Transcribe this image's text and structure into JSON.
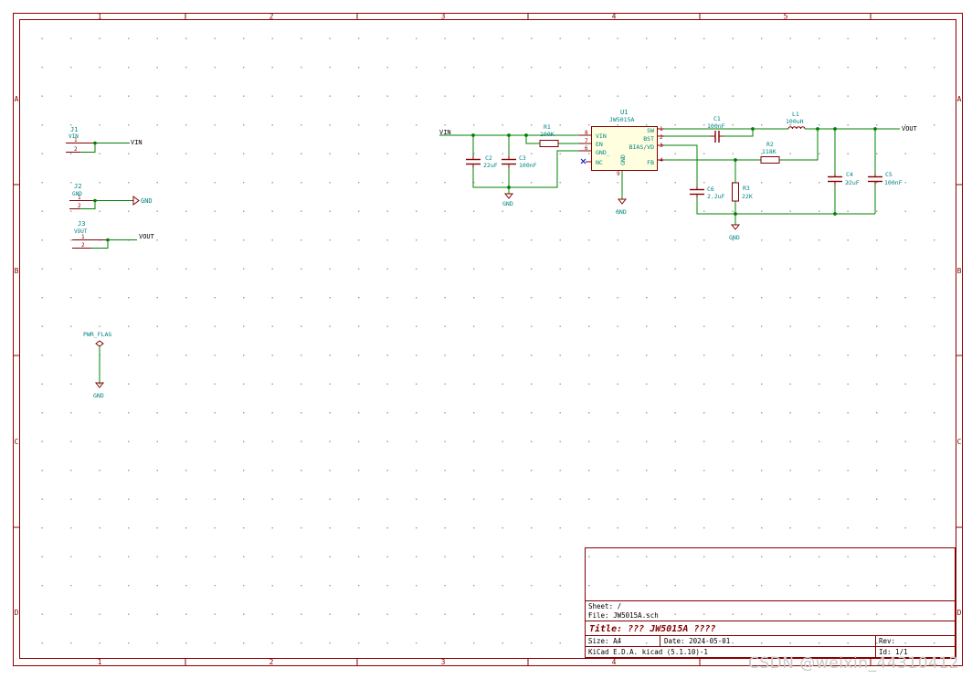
{
  "frame": {
    "col_labels": [
      "1",
      "2",
      "3",
      "4",
      "5"
    ],
    "row_labels": [
      "A",
      "B",
      "C",
      "D"
    ],
    "color": "#8b0000"
  },
  "colors": {
    "wire": "#008000",
    "label": "#00808c",
    "ref": "#008484",
    "part": "#840000",
    "text": "#000000"
  },
  "connectors": [
    {
      "ref": "J1",
      "value": "VIN",
      "pins": [
        "1",
        "2"
      ],
      "net": "VIN"
    },
    {
      "ref": "J2",
      "value": "GND",
      "pins": [
        "1",
        "2"
      ],
      "net": "GND"
    },
    {
      "ref": "J3",
      "value": "VOUT",
      "pins": [
        "1",
        "2"
      ],
      "net": "VOUT"
    }
  ],
  "pwr_flag": {
    "label": "PWR_FLAG",
    "gnd": "GND"
  },
  "ic": {
    "ref": "U1",
    "value": "JW5015A",
    "left_pins": [
      {
        "num": "8",
        "name": "VIN"
      },
      {
        "num": "7",
        "name": "EN"
      },
      {
        "num": "6",
        "name": "GND_"
      },
      {
        "num": "",
        "name": "NC"
      }
    ],
    "right_pins": [
      {
        "num": "1",
        "name": "SW"
      },
      {
        "num": "2",
        "name": "BST"
      },
      {
        "num": "3",
        "name": "BIAS/VD"
      },
      {
        "num": "4",
        "name": "FB"
      }
    ],
    "gnd_pin_label": "GND",
    "bottom_pin_num": "9"
  },
  "nets": {
    "vin": "VIN",
    "vout": "VOUT",
    "gnd": "GND"
  },
  "components": {
    "R1": {
      "ref": "R1",
      "value": "100K"
    },
    "R2": {
      "ref": "R2",
      "value": "118K"
    },
    "R3": {
      "ref": "R3",
      "value": "22K"
    },
    "C1": {
      "ref": "C1",
      "value": "100nF"
    },
    "C2": {
      "ref": "C2",
      "value": "22uF"
    },
    "C3": {
      "ref": "C3",
      "value": "100nF"
    },
    "C4": {
      "ref": "C4",
      "value": "22uF"
    },
    "C5": {
      "ref": "C5",
      "value": "100nF"
    },
    "C6": {
      "ref": "C6",
      "value": "2.2uF"
    },
    "L1": {
      "ref": "L1",
      "value": "100uH"
    }
  },
  "title_block": {
    "sheet": "Sheet: /",
    "file": "File: JW5015A.sch",
    "title": "Title: ???  JW5015A  ????",
    "size": "Size: A4",
    "date": "Date: 2024-05-01",
    "rev": "Rev:",
    "tool": "KiCad E.D.A.  kicad (5.1.10)-1",
    "id": "Id: 1/1"
  },
  "watermark": "CSDN @weixin_44310412"
}
